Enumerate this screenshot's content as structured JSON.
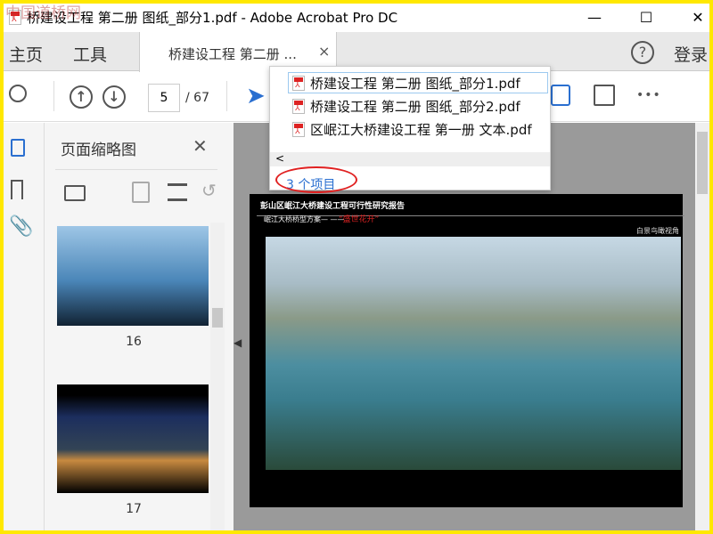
{
  "watermark": "中国道桥网",
  "window": {
    "title": "桥建设工程 第二册 图纸_部分1.pdf - Adobe Acrobat Pro DC",
    "minimize": "—",
    "maximize": "☐",
    "close": "✕"
  },
  "tabs": {
    "home": "主页",
    "tools": "工具",
    "doc_tab": "桥建设工程 第二册 ...",
    "doc_tab_close": "×",
    "help": "?",
    "login": "登录"
  },
  "toolbar": {
    "page_current": "5",
    "page_total": "/ 67",
    "more": "•••"
  },
  "dropdown": {
    "items": [
      "桥建设工程 第二册 图纸_部分1.pdf",
      "桥建设工程 第二册 图纸_部分2.pdf",
      "区岷江大桥建设工程 第一册 文本.pdf"
    ],
    "scroll_left": "<",
    "count": "3 个项目"
  },
  "panel": {
    "title": "页面缩略图",
    "close": "✕",
    "thumbnails": [
      {
        "page": "16"
      },
      {
        "page": "17"
      }
    ]
  },
  "page": {
    "report_title": "彭山区岷江大桥建设工程可行性研究报告",
    "subtitle": "岷江大桥桥型方案— ——",
    "scheme_name": "“盛世花开”",
    "view_label": "白景鸟瞰视角"
  },
  "colors": {
    "accent": "#2a6fd0",
    "annotation": "#e02020"
  }
}
